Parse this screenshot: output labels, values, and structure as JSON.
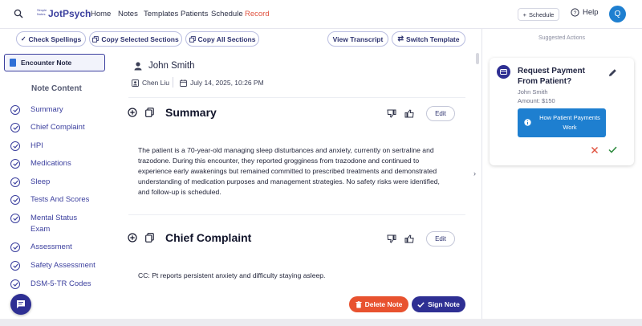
{
  "nav": {
    "brand_tagline": "Simple Notes",
    "brand_name": "JotPsych",
    "links": [
      "Home",
      "Notes",
      "Templates",
      "Patients",
      "Schedule",
      "Record"
    ],
    "schedule_button": "Schedule",
    "help": "Help",
    "avatar_initial": "Q"
  },
  "toolbar": {
    "check_spellings": "Check Spellings",
    "copy_selected": "Copy Selected Sections",
    "copy_all": "Copy All Sections",
    "view_transcript": "View Transcript",
    "switch_template": "Switch Template"
  },
  "sidebar": {
    "tab": "Encounter Note",
    "heading": "Note Content",
    "items": [
      "Summary",
      "Chief Complaint",
      "HPI",
      "Medications",
      "Sleep",
      "Tests And Scores",
      "Mental Status Exam",
      "Assessment",
      "Safety Assessment",
      "DSM-5-TR Codes"
    ]
  },
  "note": {
    "patient_name": "John Smith",
    "clinician": "Chen Liu",
    "datetime": "July 14, 2025, 10:26 PM",
    "sections": [
      {
        "title": "Summary",
        "edit_label": "Edit",
        "body": "The patient is a 70-year-old managing sleep disturbances and anxiety, currently on sertraline and trazodone. During this encounter, they reported grogginess from trazodone and continued to experience early awakenings but remained committed to prescribed treatments and demonstrated understanding of medication purposes and management strategies. No safety risks were identified, and follow-up is scheduled."
      },
      {
        "title": "Chief Complaint",
        "edit_label": "Edit",
        "body": "CC: Pt reports persistent anxiety and difficulty staying asleep."
      }
    ],
    "delete_button": "Delete Note",
    "sign_button": "Sign Note"
  },
  "suggestions": {
    "heading": "Suggested Actions",
    "card": {
      "title": "Request Payment From Patient?",
      "patient": "John Smith",
      "amount": "Amount: $150",
      "help_button": "How Patient Payments Work"
    }
  },
  "colors": {
    "accent": "#2e2f93",
    "record": "#e0523f",
    "delete": "#e8522f",
    "info": "#1e7fd0"
  }
}
